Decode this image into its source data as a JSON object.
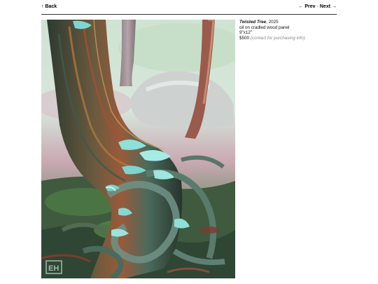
{
  "nav": {
    "back_label": "↑ Back",
    "prev_label": "← Prev",
    "separator": "·",
    "next_label": "Next →"
  },
  "artwork": {
    "title": "Twisted Tree",
    "year_suffix": ", 2025",
    "medium": "oil on cradled wood panel",
    "size": "9\"x12\"",
    "price": "$500",
    "price_note": "(contact for purchasing info)",
    "signature_monogram": "EH"
  }
}
